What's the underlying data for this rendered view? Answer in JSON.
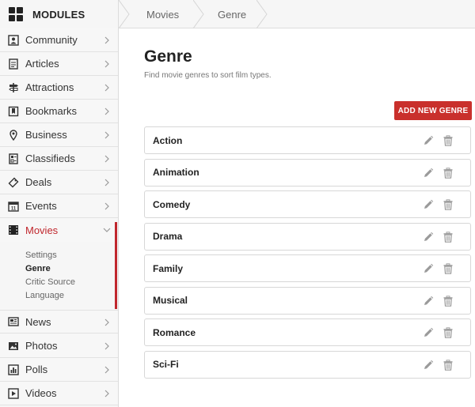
{
  "header": {
    "brand_label": "MODULES",
    "brand_icon": "grid-icon",
    "breadcrumb": [
      "Movies",
      "Genre"
    ]
  },
  "sidebar": {
    "items": [
      {
        "label": "Community",
        "icon": "people-icon"
      },
      {
        "label": "Articles",
        "icon": "article-icon"
      },
      {
        "label": "Attractions",
        "icon": "signpost-icon"
      },
      {
        "label": "Bookmarks",
        "icon": "bookmark-icon"
      },
      {
        "label": "Business",
        "icon": "map-pin-icon"
      },
      {
        "label": "Classifieds",
        "icon": "classifieds-icon"
      },
      {
        "label": "Deals",
        "icon": "tag-icon"
      },
      {
        "label": "Events",
        "icon": "calendar-icon"
      },
      {
        "label": "Movies",
        "icon": "film-icon",
        "active": true
      },
      {
        "label": "News",
        "icon": "newspaper-icon"
      },
      {
        "label": "Photos",
        "icon": "photo-icon"
      },
      {
        "label": "Polls",
        "icon": "poll-icon"
      },
      {
        "label": "Videos",
        "icon": "video-icon"
      }
    ],
    "movies_sub": [
      "Settings",
      "Genre",
      "Critic Source",
      "Language"
    ],
    "current_sub": "Genre",
    "accent": "#c0272d"
  },
  "main": {
    "title": "Genre",
    "subtitle": "Find movie genres to sort film types.",
    "add_button": "ADD NEW GENRE",
    "add_button_color": "#c9302c",
    "genres": [
      "Action",
      "Animation",
      "Comedy",
      "Drama",
      "Family",
      "Musical",
      "Romance",
      "Sci-Fi"
    ]
  }
}
